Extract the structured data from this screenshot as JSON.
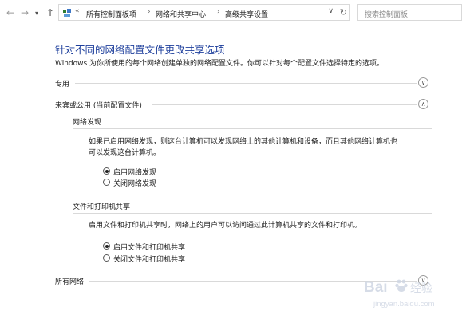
{
  "address_bar": {
    "breadcrumbs": [
      "所有控制面板项",
      "网络和共享中心",
      "高级共享设置"
    ],
    "overflow_marker": "«",
    "search_placeholder": "搜索控制面板"
  },
  "page": {
    "title": "针对不同的网络配置文件更改共享选项",
    "description": "Windows 为你所使用的每个网络创建单独的网络配置文件。你可以针对每个配置文件选择特定的选项。"
  },
  "profiles": [
    {
      "label": "专用",
      "expanded": false
    },
    {
      "label": "来宾或公用 (当前配置文件)",
      "expanded": true
    },
    {
      "label": "所有网络",
      "expanded": false
    }
  ],
  "network_discovery": {
    "heading": "网络发现",
    "description_line1": "如果已启用网络发现，则这台计算机可以发现网络上的其他计算机和设备，而且其他网络计算机也",
    "description_line2": "可以发现这台计算机。",
    "options": [
      {
        "label": "启用网络发现",
        "selected": true
      },
      {
        "label": "关闭网络发现",
        "selected": false
      }
    ]
  },
  "file_printer_sharing": {
    "heading": "文件和打印机共享",
    "description": "启用文件和打印机共享时，网络上的用户可以访问通过此计算机共享的文件和打印机。",
    "options": [
      {
        "label": "启用文件和打印机共享",
        "selected": true
      },
      {
        "label": "关闭文件和打印机共享",
        "selected": false
      }
    ]
  },
  "watermark": {
    "logo_text": "Bai",
    "logo_suffix": "经验",
    "url": "jingyan.baidu.com"
  },
  "colors": {
    "title_blue": "#1e3f9c",
    "rule_gray": "#d9d9d9",
    "watermark_blue": "#2f63c9"
  }
}
